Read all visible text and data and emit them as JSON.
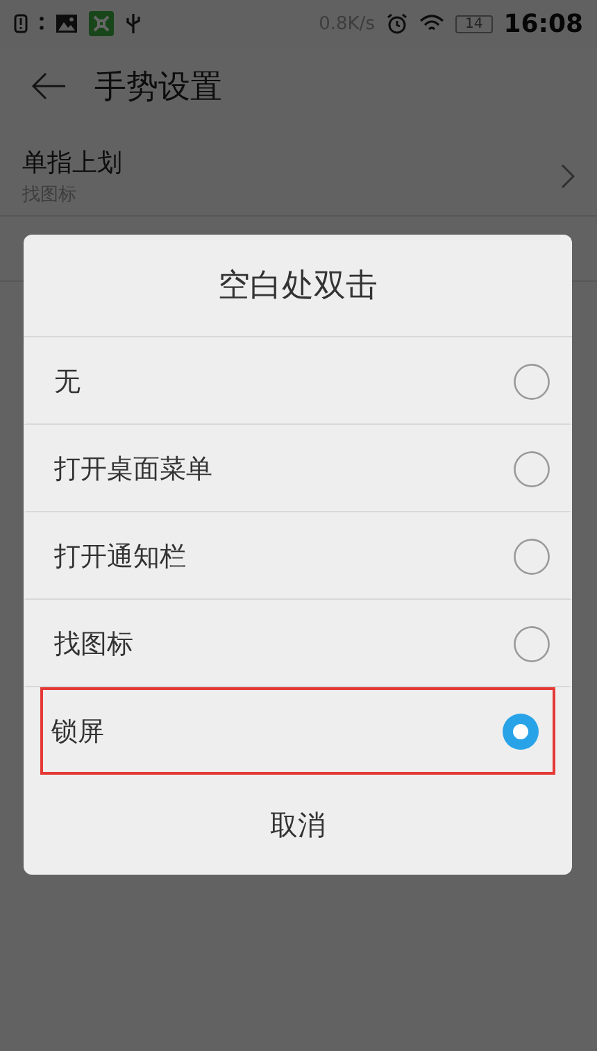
{
  "status_bar": {
    "speed": "0.8K/s",
    "battery": "14",
    "time": "16:08"
  },
  "header": {
    "title": "手势设置"
  },
  "settings": [
    {
      "title": "单指上划",
      "value": "找图标"
    }
  ],
  "dialog": {
    "title": "空白处双击",
    "options": [
      {
        "label": "无",
        "selected": false,
        "highlighted": false
      },
      {
        "label": "打开桌面菜单",
        "selected": false,
        "highlighted": false
      },
      {
        "label": "打开通知栏",
        "selected": false,
        "highlighted": false
      },
      {
        "label": "找图标",
        "selected": false,
        "highlighted": false
      },
      {
        "label": "锁屏",
        "selected": true,
        "highlighted": true
      }
    ],
    "cancel": "取消"
  }
}
